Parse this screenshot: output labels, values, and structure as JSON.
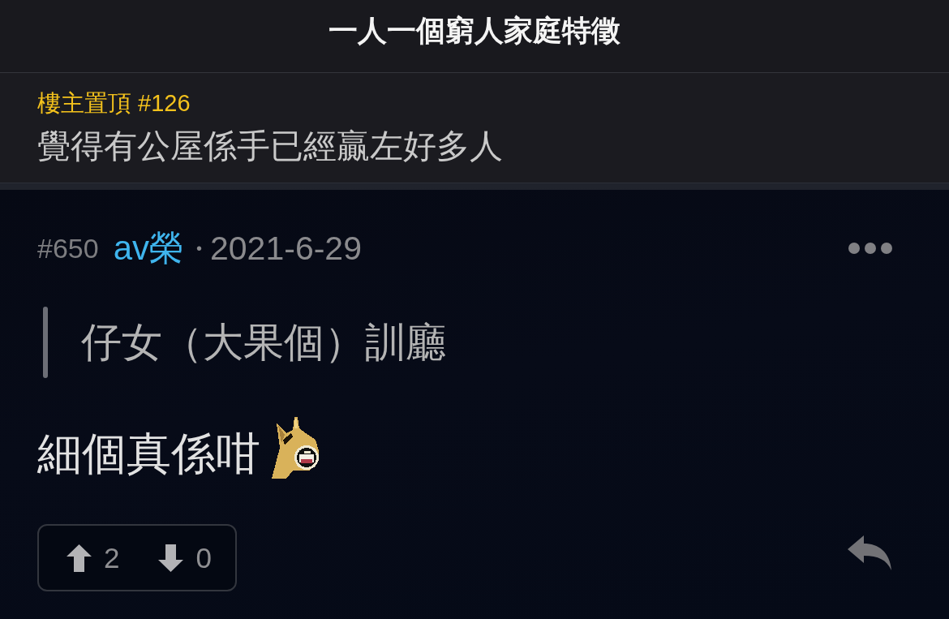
{
  "header": {
    "title": "一人一個窮人家庭特徵"
  },
  "pinned": {
    "label": "樓主置頂 #126",
    "text": "覺得有公屋係手已經贏左好多人"
  },
  "post": {
    "number": "#650",
    "author": "av榮",
    "separator": "•",
    "date": "2021-6-29",
    "quote": "仔女（大果個）訓廳",
    "body": "細個真係咁",
    "votes": {
      "up": "2",
      "down": "0"
    }
  }
}
